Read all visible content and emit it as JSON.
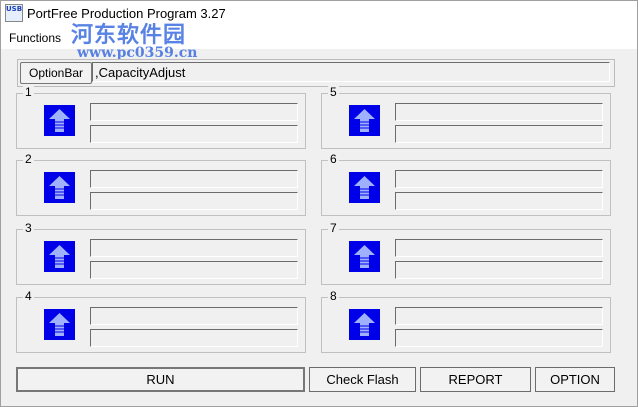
{
  "window": {
    "title": "PortFree Production Program 3.27",
    "app_icon_text": "USB"
  },
  "menu": {
    "functions": "Functions"
  },
  "watermark": {
    "text": "河东软件园",
    "url": "www.pc0359.cn"
  },
  "option_bar": {
    "button_label": "OptionBar",
    "value": ",CapacityAdjust"
  },
  "ports": [
    {
      "num": "1"
    },
    {
      "num": "2"
    },
    {
      "num": "3"
    },
    {
      "num": "4"
    },
    {
      "num": "5"
    },
    {
      "num": "6"
    },
    {
      "num": "7"
    },
    {
      "num": "8"
    }
  ],
  "buttons": {
    "run": "RUN",
    "check_flash": "Check Flash",
    "report": "REPORT",
    "option": "OPTION"
  },
  "colors": {
    "port_icon": "#0000e8",
    "watermark": "#3c6de0"
  }
}
